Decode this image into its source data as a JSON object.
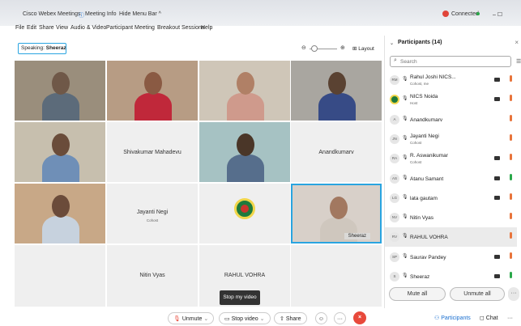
{
  "titlebar": {
    "app_title": "Cisco Webex Meetings",
    "meeting_info": "Meeting Info",
    "hide_menu_bar": "Hide Menu Bar ^",
    "connection_status": "Connected",
    "window_controls": "–  ☐"
  },
  "menu": {
    "items": [
      "File",
      "Edit",
      "Share",
      "View",
      "Audio & Video",
      "Participant",
      "Meeting",
      "Breakout Sessions",
      "Help"
    ]
  },
  "speaking": {
    "prefix": "Speaking:",
    "name": "Sheeraz"
  },
  "zoom": {
    "minus": "⊖",
    "plus": "⊕"
  },
  "layout_button": "Layout",
  "grid": {
    "tiles": [
      {
        "name": "",
        "kind": "video",
        "skin": "#6f5848",
        "bg": "#9a8e7c",
        "shirt": "#5c6b7a"
      },
      {
        "name": "",
        "kind": "video",
        "skin": "#8a5a43",
        "bg": "#b79c84",
        "shirt": "#c0283a"
      },
      {
        "name": "",
        "kind": "video",
        "skin": "#b08066",
        "bg": "#cfc6b8",
        "shirt": "#cf9a8c"
      },
      {
        "name": "",
        "kind": "video",
        "skin": "#5a4232",
        "bg": "#a9a6a0",
        "shirt": "#374b86"
      },
      {
        "name": "",
        "kind": "video",
        "skin": "#6a4c3a",
        "bg": "#c7bfae",
        "shirt": "#6f8fb7"
      },
      {
        "name": "Shivakumar Mahadevu",
        "kind": "name"
      },
      {
        "name": "",
        "kind": "video",
        "skin": "#4a3628",
        "bg": "#a6c2c3",
        "shirt": "#566e8c"
      },
      {
        "name": "Anandkumarv",
        "kind": "name"
      },
      {
        "name": "",
        "kind": "video",
        "skin": "#6b4b3a",
        "bg": "#c8a887",
        "shirt": "#c7d2de"
      },
      {
        "name": "Jayanti Negi",
        "sub": "Cohost",
        "kind": "name"
      },
      {
        "name": "",
        "kind": "logo"
      },
      {
        "name": "Sheeraz",
        "kind": "video",
        "skin": "#a27860",
        "bg": "#d8d0c9",
        "shirt": "#cfc7be"
      },
      {
        "name": "",
        "kind": "blank"
      },
      {
        "name": "Nitin Vyas",
        "kind": "name"
      },
      {
        "name": "RAHUL VOHRA",
        "kind": "name"
      },
      {
        "name": "",
        "kind": "blank"
      }
    ]
  },
  "participants": {
    "title": "Participants (14)",
    "search_placeholder": "Search",
    "rows": [
      {
        "initials": "RM",
        "name": "Rahul Joshi NICS...",
        "role": "Cohost, me",
        "cam": true,
        "mic": "#e8743b"
      },
      {
        "initials": "",
        "name": "NICS Noida",
        "role": "Host",
        "cam": true,
        "mic": "#e8743b"
      },
      {
        "initials": "A",
        "name": "Anandkumarv",
        "role": "",
        "cam": false,
        "mic": "#e8743b"
      },
      {
        "initials": "JN",
        "name": "Jayanti Negi",
        "role": "Cohost",
        "cam": false,
        "mic": "#e8743b"
      },
      {
        "initials": "RA",
        "name": "R. Aswanikumar",
        "role": "Cohost",
        "cam": true,
        "mic": "#e8743b"
      },
      {
        "initials": "AS",
        "name": "Atanu Samant",
        "role": "",
        "cam": true,
        "mic": "#2aa84a"
      },
      {
        "initials": "LG",
        "name": "lata gautam",
        "role": "",
        "cam": true,
        "mic": "#e8743b"
      },
      {
        "initials": "NV",
        "name": "Nitin Vyas",
        "role": "",
        "cam": false,
        "mic": "#e8743b"
      },
      {
        "initials": "RV",
        "name": "RAHUL VOHRA",
        "role": "",
        "cam": false,
        "mic": "#e8743b"
      },
      {
        "initials": "SP",
        "name": "Saurav Pandey",
        "role": "",
        "cam": true,
        "mic": "#e8743b"
      },
      {
        "initials": "S",
        "name": "Sheeraz",
        "role": "",
        "cam": true,
        "mic": "#2aa84a"
      }
    ],
    "mute_all": "Mute all",
    "unmute_all": "Unmute all",
    "more": "···"
  },
  "toolbar": {
    "unmute": "Unmute",
    "stop_video": "Stop video",
    "share": "Share",
    "participants": "Participants",
    "chat": "Chat",
    "tooltip": "Stop my video"
  },
  "colors": {
    "accent": "#29a4e0",
    "end": "#e8493b",
    "muted": "#e8743b",
    "active": "#2aa84a"
  }
}
